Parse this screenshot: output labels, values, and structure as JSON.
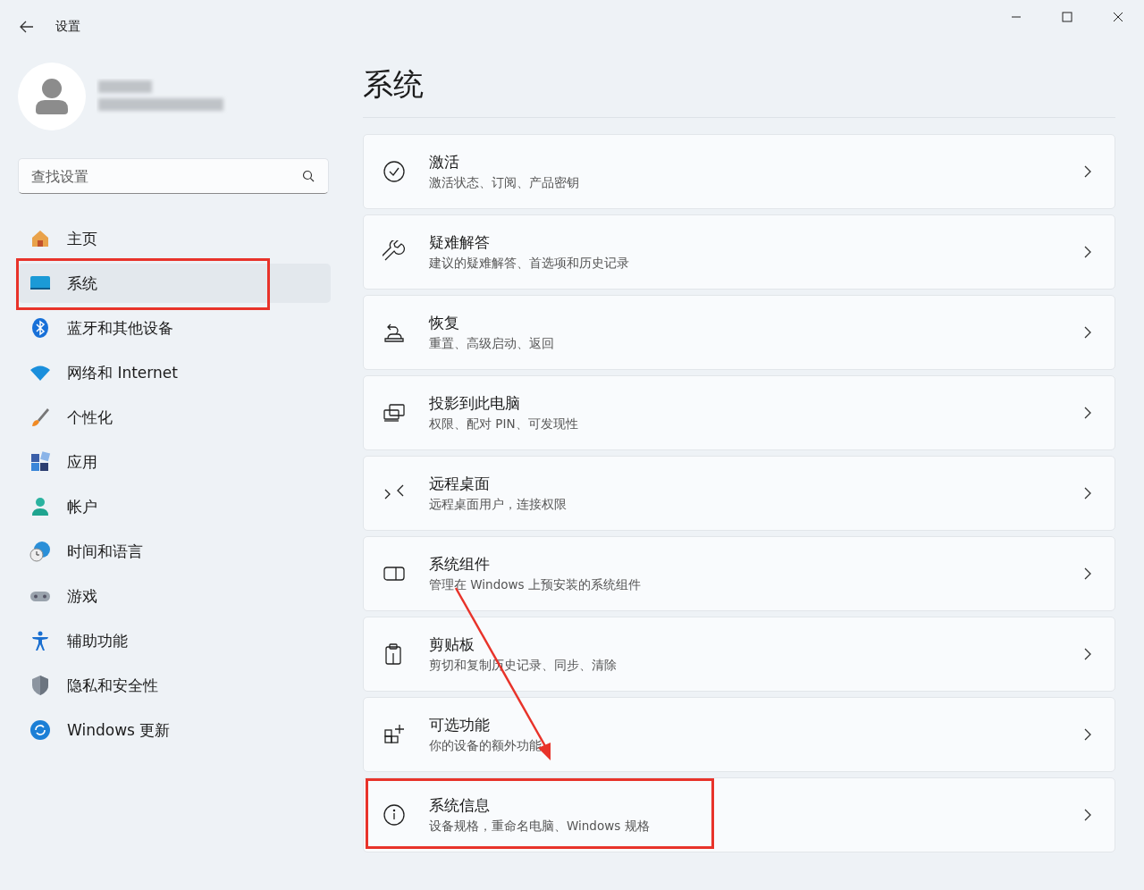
{
  "window": {
    "title": "设置"
  },
  "search": {
    "placeholder": "查找设置"
  },
  "sidebar": {
    "items": [
      {
        "label": "主页",
        "selected": false,
        "highlighted": false
      },
      {
        "label": "系统",
        "selected": true,
        "highlighted": true
      },
      {
        "label": "蓝牙和其他设备",
        "selected": false,
        "highlighted": false
      },
      {
        "label": "网络和 Internet",
        "selected": false,
        "highlighted": false
      },
      {
        "label": "个性化",
        "selected": false,
        "highlighted": false
      },
      {
        "label": "应用",
        "selected": false,
        "highlighted": false
      },
      {
        "label": "帐户",
        "selected": false,
        "highlighted": false
      },
      {
        "label": "时间和语言",
        "selected": false,
        "highlighted": false
      },
      {
        "label": "游戏",
        "selected": false,
        "highlighted": false
      },
      {
        "label": "辅助功能",
        "selected": false,
        "highlighted": false
      },
      {
        "label": "隐私和安全性",
        "selected": false,
        "highlighted": false
      },
      {
        "label": "Windows 更新",
        "selected": false,
        "highlighted": false
      }
    ]
  },
  "page": {
    "title": "系统",
    "cards": [
      {
        "title": "激活",
        "subtitle": "激活状态、订阅、产品密钥",
        "highlighted": false
      },
      {
        "title": "疑难解答",
        "subtitle": "建议的疑难解答、首选项和历史记录",
        "highlighted": false
      },
      {
        "title": "恢复",
        "subtitle": "重置、高级启动、返回",
        "highlighted": false
      },
      {
        "title": "投影到此电脑",
        "subtitle": "权限、配对 PIN、可发现性",
        "highlighted": false
      },
      {
        "title": "远程桌面",
        "subtitle": "远程桌面用户，连接权限",
        "highlighted": false
      },
      {
        "title": "系统组件",
        "subtitle": "管理在 Windows 上预安装的系统组件",
        "highlighted": false
      },
      {
        "title": "剪贴板",
        "subtitle": "剪切和复制历史记录、同步、清除",
        "highlighted": false
      },
      {
        "title": "可选功能",
        "subtitle": "你的设备的额外功能",
        "highlighted": false
      },
      {
        "title": "系统信息",
        "subtitle": "设备规格，重命名电脑、Windows 规格",
        "highlighted": true
      }
    ]
  }
}
